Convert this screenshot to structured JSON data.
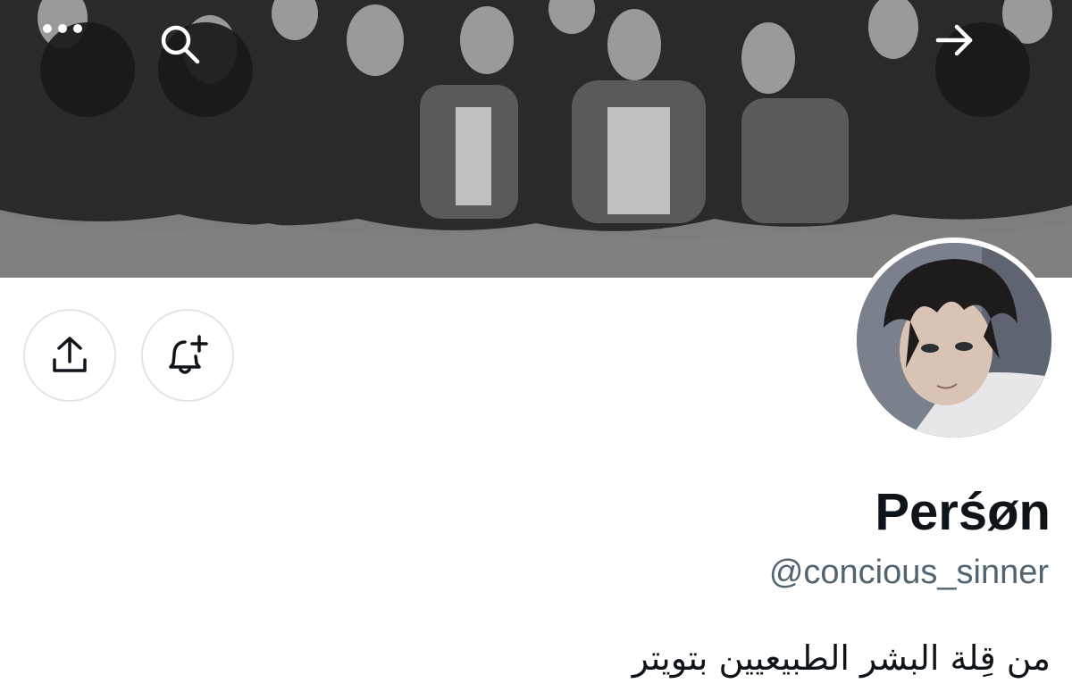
{
  "header": {
    "banner_image": "group-photo-grayscale",
    "more_icon": "more-horizontal-icon",
    "search_icon": "search-icon",
    "forward_icon": "arrow-right-icon"
  },
  "actions": {
    "share_icon": "share-upload-icon",
    "notify_icon": "bell-plus-icon"
  },
  "profile": {
    "display_name": "Perśøn",
    "handle": "@concious_sinner",
    "bio": "من قِلة البشر الطبيعيين بتويتر",
    "avatar": "anime-boy-avatar"
  },
  "colors": {
    "name": "#0f1419",
    "handle": "#536471",
    "button_border": "#e1e5e8",
    "overlay_button": "#191919"
  }
}
